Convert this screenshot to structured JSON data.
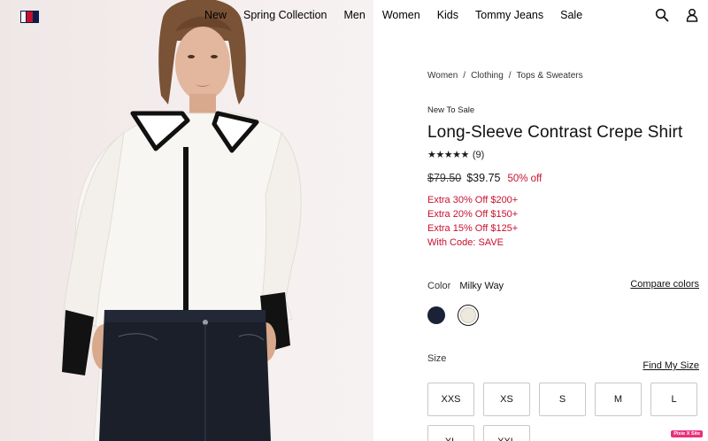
{
  "nav": {
    "links": [
      "New",
      "Spring Collection",
      "Men",
      "Women",
      "Kids",
      "Tommy Jeans",
      "Sale"
    ],
    "icons": [
      "search-icon",
      "account-icon"
    ]
  },
  "product": {
    "breadcrumb": [
      "Women",
      "Clothing",
      "Tops & Sweaters"
    ],
    "badge": "New To Sale",
    "title": "Long-Sleeve Contrast Crepe Shirt",
    "stars": "★★★★★",
    "rating_value": 5,
    "review_count": "(9)",
    "original_price": "$79.50",
    "sale_price": "$39.75",
    "discount": "50% off",
    "promos": [
      "Extra 30% Off $200+",
      "Extra 20% Off $150+",
      "Extra 15% Off $125+",
      "With Code: SAVE"
    ],
    "color_label": "Color",
    "color_value": "Milky Way",
    "compare_label": "Compare colors",
    "swatches": [
      {
        "name": "navy",
        "hex": "#1b2238"
      },
      {
        "name": "milky-way",
        "hex": "#eee8df",
        "selected": true
      }
    ],
    "size_label": "Size",
    "find_size_label": "Find My Size",
    "sizes": [
      "XXS",
      "XS",
      "S",
      "M",
      "L",
      "XL",
      "XXL"
    ]
  },
  "widget": {
    "label": "Pixie X Site"
  },
  "colors": {
    "sale_red": "#c8102e",
    "brand_navy": "#0b1c48"
  }
}
